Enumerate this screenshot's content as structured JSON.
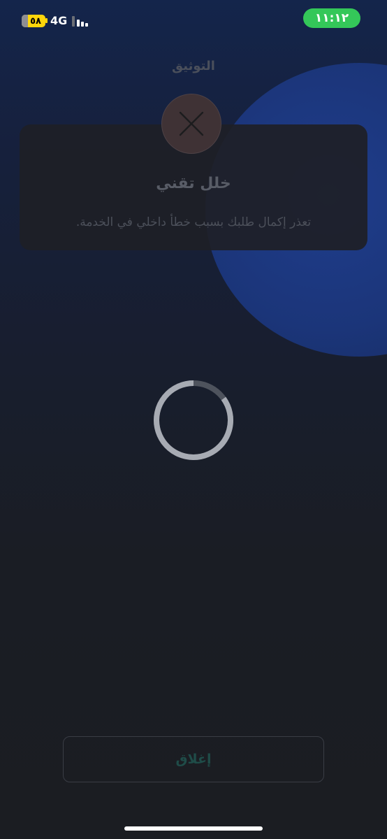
{
  "status_bar": {
    "time": "١١:١٢",
    "battery_level": "٥٨",
    "network": "4G",
    "signal_bars": 3,
    "colors": {
      "time_pill": "#34c759",
      "battery": "#ffd60a"
    }
  },
  "header": {
    "title": "التوثيق"
  },
  "error_card": {
    "icon": "close-x-icon",
    "title": "خلل تقني",
    "message": "تعذر إكمال طلبك بسبب خطأ داخلي في الخدمة."
  },
  "loading": {
    "icon": "loading-spinner-icon"
  },
  "footer": {
    "close_label": "إغلاق"
  }
}
